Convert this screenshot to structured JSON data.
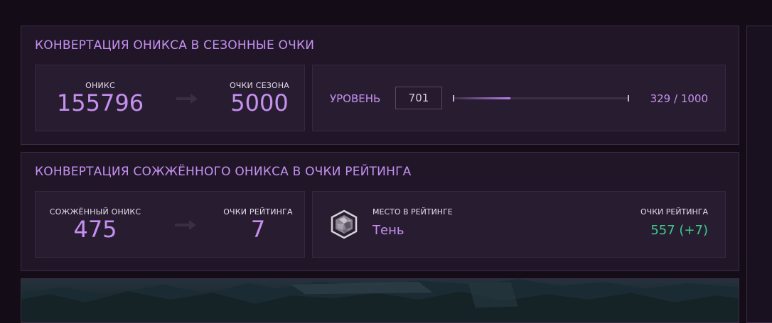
{
  "onyx_conversion": {
    "title": "Конвертация оникса в сезонные очки",
    "from_label": "ОНИКС",
    "from_value": "155796",
    "to_label": "ОЧКИ СЕЗОНА",
    "to_value": "5000",
    "level_label": "УРОВЕНЬ",
    "level_value": "701",
    "progress_current": 329,
    "progress_max": 1000,
    "progress_text": "329 / 1000"
  },
  "burned_conversion": {
    "title": "Конвертация сожжённого оникса в очки рейтинга",
    "from_label": "СОЖЖЁННЫЙ ОНИКС",
    "from_value": "475",
    "to_label": "ОЧКИ РЕЙТИНГА",
    "to_value": "7",
    "rank_label": "МЕСТО В РЕЙТИНГЕ",
    "rank_name": "Тень",
    "rank_icon": "shadow-rank-icon",
    "points_label": "ОЧКИ РЕЙТИНГА",
    "points_value": "557 (+7)"
  },
  "colors": {
    "accent": "#c590f0",
    "positive": "#3ec98d",
    "panel": "#201628",
    "background": "#140d18"
  }
}
